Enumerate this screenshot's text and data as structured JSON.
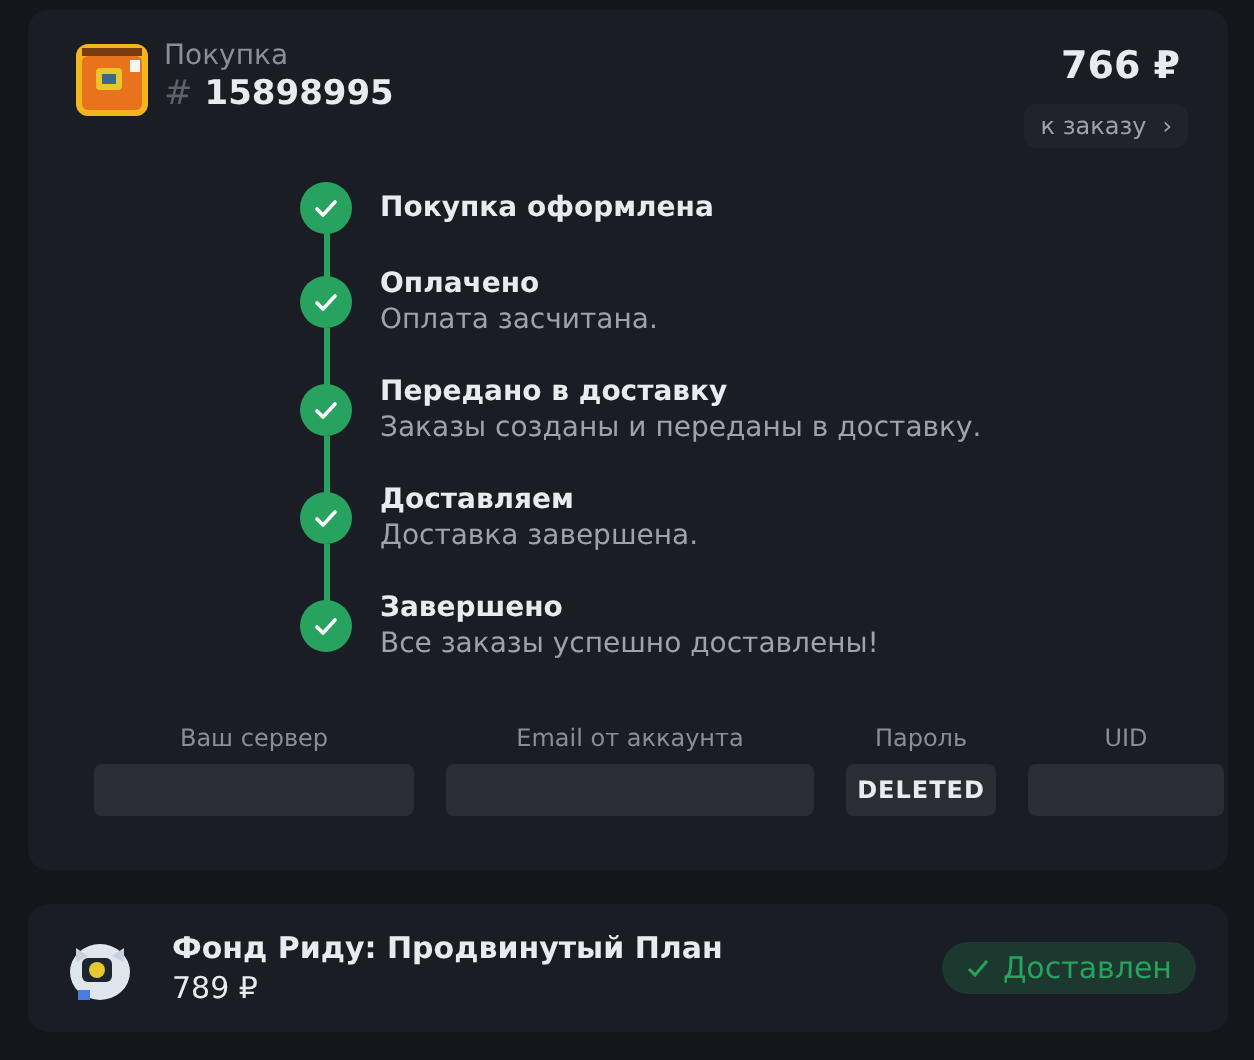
{
  "order": {
    "type_label": "Покупка",
    "hash": "#",
    "number": "15898995",
    "price": "766 ₽",
    "link": "к заказу",
    "link_arrow": "›"
  },
  "steps": [
    {
      "title": "Покупка оформлена",
      "done": true
    },
    {
      "title": "Оплачено",
      "subtitle": "Оплата засчитана.",
      "done": true
    },
    {
      "title": "Передано в доставку",
      "subtitle": "Заказы созданы и переданы в доставку.",
      "done": true
    },
    {
      "title": "Доставляем",
      "subtitle": "Доставка завершена.",
      "done": true
    },
    {
      "title": "Завершено",
      "subtitle": "Все заказы успешно доставлены!",
      "done": true
    }
  ],
  "fields": [
    {
      "label": "Ваш сервер"
    },
    {
      "label": "Email от аккаунта"
    },
    {
      "label": "Пароль",
      "value": "DELETED"
    },
    {
      "label": "UID"
    }
  ],
  "item": {
    "name": "Фонд Риду: Продвинутый План",
    "price": "789 ₽",
    "status": {
      "kind": "delivered",
      "label": "Доставлен"
    }
  }
}
